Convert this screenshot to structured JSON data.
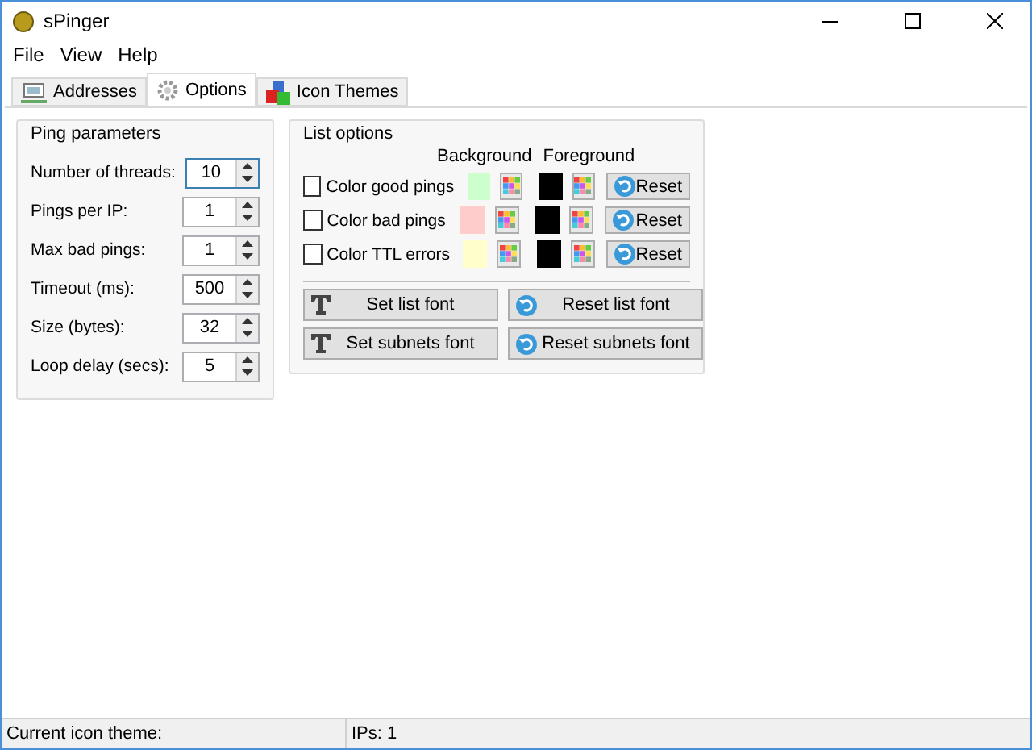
{
  "window": {
    "title": "sPinger"
  },
  "menu": [
    "File",
    "View",
    "Help"
  ],
  "tabs": [
    {
      "label": "Addresses",
      "selected": false
    },
    {
      "label": "Options",
      "selected": true
    },
    {
      "label": "Icon Themes",
      "selected": false
    }
  ],
  "ping_parameters": {
    "title": "Ping parameters",
    "fields": [
      {
        "label": "Number of threads:",
        "value": "10",
        "focused": true
      },
      {
        "label": "Pings per IP:",
        "value": "1",
        "focused": false
      },
      {
        "label": "Max bad pings:",
        "value": "1",
        "focused": false
      },
      {
        "label": "Timeout (ms):",
        "value": "500",
        "focused": false
      },
      {
        "label": "Size (bytes):",
        "value": "32",
        "focused": false
      },
      {
        "label": "Loop delay (secs):",
        "value": "5",
        "focused": false
      }
    ]
  },
  "list_options": {
    "title": "List options",
    "background_header": "Background",
    "foreground_header": "Foreground",
    "rows": [
      {
        "label": "Color good pings",
        "checked": false,
        "swatches": [
          {
            "color": "#ccffcc"
          },
          {
            "color": "#000000"
          }
        ],
        "reset": "Reset"
      },
      {
        "label": "Color bad pings",
        "checked": false,
        "swatches": [
          {
            "color": "#ffcccc"
          },
          {
            "color": "#000000"
          }
        ],
        "reset": "Reset"
      },
      {
        "label": "Color TTL errors",
        "checked": false,
        "swatches": [
          {
            "color": "#ffffcc"
          },
          {
            "color": "#000000"
          }
        ],
        "reset": "Reset"
      }
    ],
    "font_buttons": [
      {
        "label": "Set list font",
        "kind": "set"
      },
      {
        "label": "Reset list font",
        "kind": "reset"
      },
      {
        "label": "Set subnets font",
        "kind": "set"
      },
      {
        "label": "Reset subnets font",
        "kind": "reset"
      }
    ]
  },
  "status_bar": [
    "Current icon theme:",
    "IPs: 1"
  ]
}
